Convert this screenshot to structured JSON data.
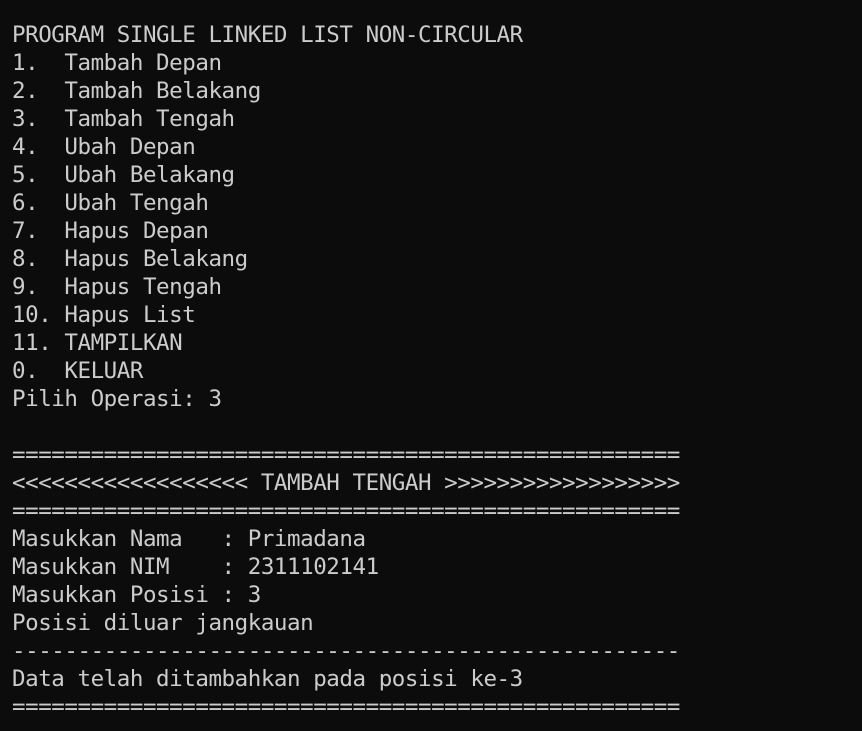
{
  "window": {
    "background": "#0c0c0c",
    "foreground": "#cccccc"
  },
  "program_title": "PROGRAM SINGLE LINKED LIST NON-CIRCULAR",
  "menu": [
    "1.  Tambah Depan",
    "2.  Tambah Belakang",
    "3.  Tambah Tengah",
    "4.  Ubah Depan",
    "5.  Ubah Belakang",
    "6.  Ubah Tengah",
    "7.  Hapus Depan",
    "8.  Hapus Belakang",
    "9.  Hapus Tengah",
    "10. Hapus List",
    "11. TAMPILKAN",
    "0.  KELUAR"
  ],
  "prompt": "Pilih Operasi: 3",
  "double_separator": "===================================================",
  "section_header": "<<<<<<<<<<<<<<<<<< TAMBAH TENGAH >>>>>>>>>>>>>>>>>>",
  "inputs": {
    "nama": "Masukkan Nama   : Primadana",
    "nim": "Masukkan NIM    : 2311102141",
    "posisi": "Masukkan Posisi : 3"
  },
  "message_out_of_range": "Posisi diluar jangkauan",
  "single_separator": "---------------------------------------------------",
  "message_success": "Data telah ditambahkan pada posisi ke-3"
}
